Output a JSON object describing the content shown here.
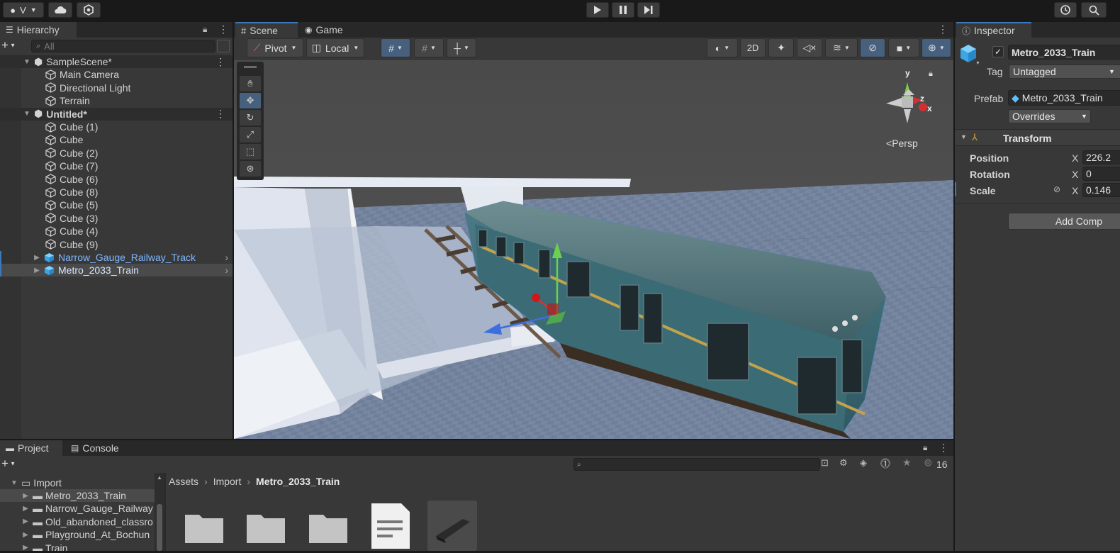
{
  "topbar": {
    "account_label": "V",
    "play_icon": "play-icon",
    "pause_icon": "pause-icon",
    "step_icon": "step-icon"
  },
  "hierarchy": {
    "tab_label": "Hierarchy",
    "search_placeholder": "All",
    "scenes": [
      {
        "name": "SampleScene*",
        "children": [
          "Main Camera",
          "Directional Light",
          "Terrain"
        ]
      },
      {
        "name": "Untitled*",
        "children": [
          "Cube (1)",
          "Cube",
          "Cube (2)",
          "Cube (7)",
          "Cube (6)",
          "Cube (8)",
          "Cube (5)",
          "Cube (3)",
          "Cube (4)",
          "Cube (9)"
        ]
      }
    ],
    "prefabs": [
      "Narrow_Gauge_Railway_Track",
      "Metro_2033_Train"
    ]
  },
  "scene_view": {
    "tab_scene": "Scene",
    "tab_game": "Game",
    "pivot_label": "Pivot",
    "local_label": "Local",
    "mode_2d": "2D",
    "persp_label": "Persp",
    "gizmo_y": "y",
    "gizmo_z": "z",
    "gizmo_x": "x"
  },
  "inspector": {
    "tab_label": "Inspector",
    "object_name": "Metro_2033_Train",
    "tag_label": "Tag",
    "tag_value": "Untagged",
    "prefab_label": "Prefab",
    "prefab_value": "Metro_2033_Train",
    "overrides_label": "Overrides",
    "transform_label": "Transform",
    "position_label": "Position",
    "rotation_label": "Rotation",
    "scale_label": "Scale",
    "axis_x": "X",
    "position_x": "226.2",
    "rotation_x": "0",
    "scale_x": "0.146",
    "add_component_label": "Add Comp"
  },
  "project": {
    "tab_project": "Project",
    "tab_console": "Console",
    "hidden_count": "16",
    "breadcrumb": [
      "Assets",
      "Import",
      "Metro_2033_Train"
    ],
    "tree_root": "Import",
    "tree_items": [
      "Metro_2033_Train",
      "Narrow_Gauge_Railway",
      "Old_abandoned_classro",
      "Playground_At_Bochun",
      "Train"
    ]
  },
  "colors": {
    "accent_blue": "#3a79bb",
    "prefab_text": "#7eb6ff",
    "panel_bg": "#383838"
  }
}
